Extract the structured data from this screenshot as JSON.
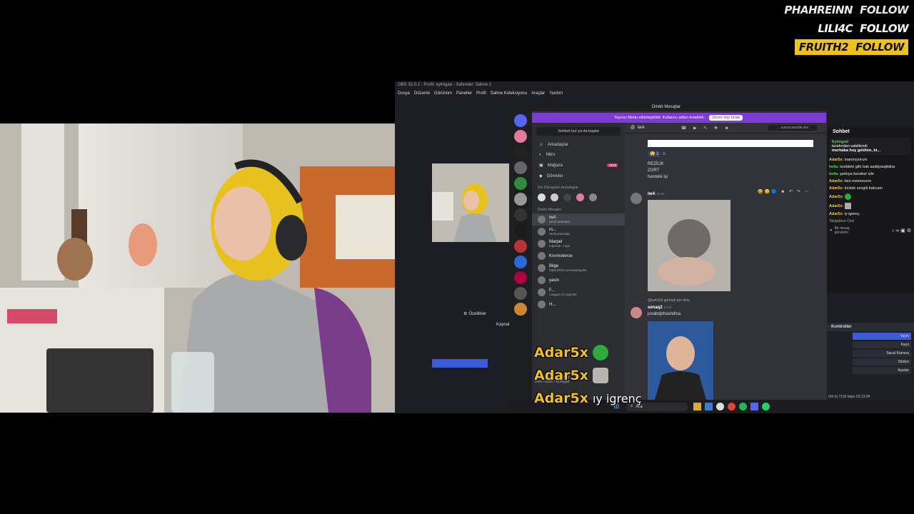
{
  "follows": [
    {
      "name": "PHAHREINN",
      "action": "FOLLOW"
    },
    {
      "name": "LILI4C",
      "action": "FOLLOW"
    },
    {
      "name": "FRUITH2",
      "action": "FOLLOW"
    }
  ],
  "obs": {
    "title": "OBS 32.0.2 - Profil: eyimgad - Sahneler: Sahne 1",
    "menu": [
      "Dosya",
      "Düzenle",
      "Görünüm",
      "Paneller",
      "Profil",
      "Sahne Koleksiyonu",
      "Araçlar",
      "Yardım"
    ],
    "filters_label": "Özellikler",
    "sources_header": "Kaynak",
    "controls": {
      "header": "Kontroller",
      "buttons": [
        "Yayın",
        "Kayıt",
        "Sanal Kamera",
        "Stüdyo",
        "Ayarlar"
      ]
    },
    "status": "(60.0) 7193 kbps 03:13:04"
  },
  "discord": {
    "window_title": "Direkt Mesajlar",
    "banner": {
      "text": "Yayıncı Modu etkinleştirildi. Kullanıcı adları kısaltıldı.",
      "button": "Devre dışı bırak"
    },
    "dm_search": "Sohbet bul ya da başlat",
    "nav": [
      {
        "icon": "friends-icon",
        "label": "Arkadaşlar"
      },
      {
        "icon": "nitro-icon",
        "label": "Nitro"
      },
      {
        "icon": "shop-icon",
        "label": "Mağaza",
        "badge": "YENİ"
      },
      {
        "icon": "quests-icon",
        "label": "Görevler"
      }
    ],
    "frequent_header": "Sık Görüşülen Arkadaşlar",
    "dm_header": "Direkt Mesajlar",
    "dms": [
      {
        "name": "iwA",
        "status": "Şeali aramada"
      },
      {
        "name": "m...",
        "status": "Sesli aramada"
      },
      {
        "name": "Marpel",
        "status": "mlperde - mpa"
      },
      {
        "name": "Kıvımslence",
        "status": ""
      },
      {
        "name": "Bilge",
        "status": "https://kick.com/weeeyphe"
      },
      {
        "name": "yasin",
        "status": ""
      },
      {
        "name": "F...",
        "status": "League of Legends"
      },
      {
        "name": "H...",
        "status": ""
      }
    ],
    "voice_panel": {
      "title": "Ses Bağlantısı Kuruldu",
      "sub": "Ders Odası / eyimgad"
    },
    "chat_user": "iwA",
    "chat_search_placeholder": "... sunucusunda ara",
    "messages": [
      {
        "lines": [
          "REZİLİK",
          "ZORT",
          "hastalık işi"
        ]
      },
      {
        "author": "iwA",
        "time": "16:30"
      },
      {
        "reply": "@iwA  Eki görmek için tıkla",
        "author": "senaq2",
        "time": "16:32",
        "text": "josabdjxhashdlsa"
      }
    ]
  },
  "twitch_chat": {
    "header": "Sohbet",
    "pinned": {
      "user": "Eyimgad",
      "label": "tarafından sabitlendi",
      "text": "merhaba hoş geldinn, bi..."
    },
    "lines": [
      {
        "user": "Adar5x",
        "text": "inanmıyorum",
        "color": "#f7c948"
      },
      {
        "user": "iw4a",
        "text": "özeldeki gife bak asdkjnasjkdna",
        "color": "#57d35a"
      },
      {
        "user": "iw4a",
        "text": "şarkıya beraber izle",
        "color": "#57d35a"
      },
      {
        "user": "Adar5x",
        "text": "ben evienecem",
        "color": "#f7c948"
      },
      {
        "user": "Adar5x",
        "text": "kickde sevgili bakcam",
        "color": "#f7c948"
      },
      {
        "user": "Adar5x",
        "text": "",
        "color": "#f7c948"
      },
      {
        "user": "Adar5x",
        "text": "",
        "color": "#f7c948"
      },
      {
        "user": "Adar5x",
        "text": "iy igrenç",
        "color": "#f7c948"
      }
    ],
    "followers_only": "Takipçilere Özel",
    "input_placeholder": "Bir mesaj gönderin"
  },
  "taskbar": {
    "search_placeholder": "Ara"
  },
  "overlay_chat": [
    {
      "user": "Adar5x",
      "emote": "green-creature-emote",
      "text": ""
    },
    {
      "user": "Adar5x",
      "emote": "cat-emote",
      "text": ""
    },
    {
      "user": "Adar5x",
      "emote": "",
      "text": "ıy igrenç"
    }
  ],
  "colors": {
    "follow_highlight": "#f2c21b",
    "discord_banner": "#7d3bd6",
    "obs_active": "#3c5bd6"
  }
}
